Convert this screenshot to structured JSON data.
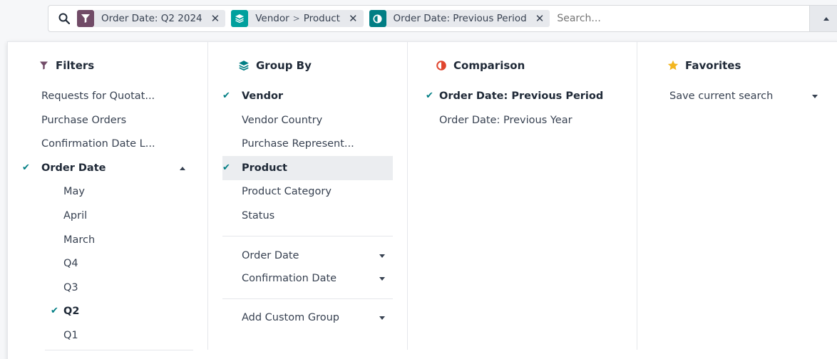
{
  "search": {
    "facets": [
      {
        "type": "filter",
        "label": "Order Date: Q2 2024"
      },
      {
        "type": "group",
        "part1": "Vendor",
        "separator": ">",
        "part2": "Product"
      },
      {
        "type": "compare",
        "label": "Order Date: Previous Period"
      }
    ],
    "placeholder": "Search...",
    "close_glyph": "✕"
  },
  "filters": {
    "header": "Filters",
    "items": [
      "Requests for Quotat...",
      "Purchase Orders",
      "Confirmation Date L..."
    ],
    "order_date": {
      "label": "Order Date",
      "checked": true,
      "expanded": true
    },
    "date_options": [
      {
        "label": "May",
        "checked": false
      },
      {
        "label": "April",
        "checked": false
      },
      {
        "label": "March",
        "checked": false
      },
      {
        "label": "Q4",
        "checked": false
      },
      {
        "label": "Q3",
        "checked": false
      },
      {
        "label": "Q2",
        "checked": true
      },
      {
        "label": "Q1",
        "checked": false
      }
    ]
  },
  "group_by": {
    "header": "Group By",
    "items": [
      {
        "label": "Vendor",
        "checked": true
      },
      {
        "label": "Vendor Country",
        "checked": false
      },
      {
        "label": "Purchase Represent...",
        "checked": false
      },
      {
        "label": "Product",
        "checked": true
      },
      {
        "label": "Product Category",
        "checked": false
      },
      {
        "label": "Status",
        "checked": false
      }
    ],
    "date_groups": [
      "Order Date",
      "Confirmation Date"
    ],
    "custom": "Add Custom Group"
  },
  "comparison": {
    "header": "Comparison",
    "items": [
      {
        "label": "Order Date: Previous Period",
        "checked": true
      },
      {
        "label": "Order Date: Previous Year",
        "checked": false
      }
    ]
  },
  "favorites": {
    "header": "Favorites",
    "save": "Save current search"
  },
  "colors": {
    "filter_badge": "#714b67",
    "group_badge": "#00a09d",
    "compare_badge": "#017e84",
    "check": "#017e84",
    "comparison_icon": "#e0452e",
    "favorite_star": "#f3b61f"
  },
  "icons": {
    "search": "search-icon",
    "filter": "funnel-icon",
    "group": "layers-icon",
    "compare": "half-circle-icon",
    "favorite": "star-icon",
    "check": "✔"
  }
}
